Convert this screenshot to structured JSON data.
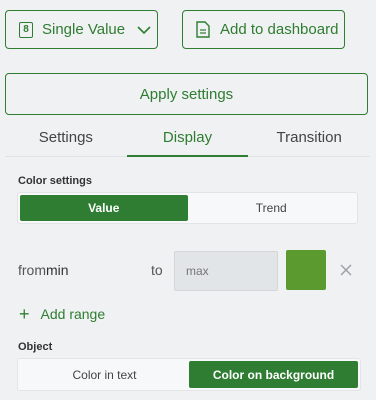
{
  "toolbar": {
    "viz_icon_text": "8",
    "viz_type": "Single Value",
    "add_dashboard": "Add to dashboard",
    "apply_settings": "Apply settings"
  },
  "tabs": [
    {
      "label": "Settings"
    },
    {
      "label": "Display"
    },
    {
      "label": "Transition"
    }
  ],
  "active_tab": "Display",
  "color_settings": {
    "label": "Color settings",
    "options": [
      {
        "label": "Value"
      },
      {
        "label": "Trend"
      }
    ],
    "selected": "Value"
  },
  "range": {
    "from_label": "from",
    "from_value": "min",
    "to_label": "to",
    "max_placeholder": "max",
    "color": "#5a9a2e",
    "add_label": "Add range"
  },
  "object": {
    "label": "Object",
    "options": [
      {
        "label": "Color in text"
      },
      {
        "label": "Color on background"
      }
    ],
    "selected": "Color on background"
  },
  "colors": {
    "accent": "#2e7d32",
    "background": "#f0f1f2"
  }
}
